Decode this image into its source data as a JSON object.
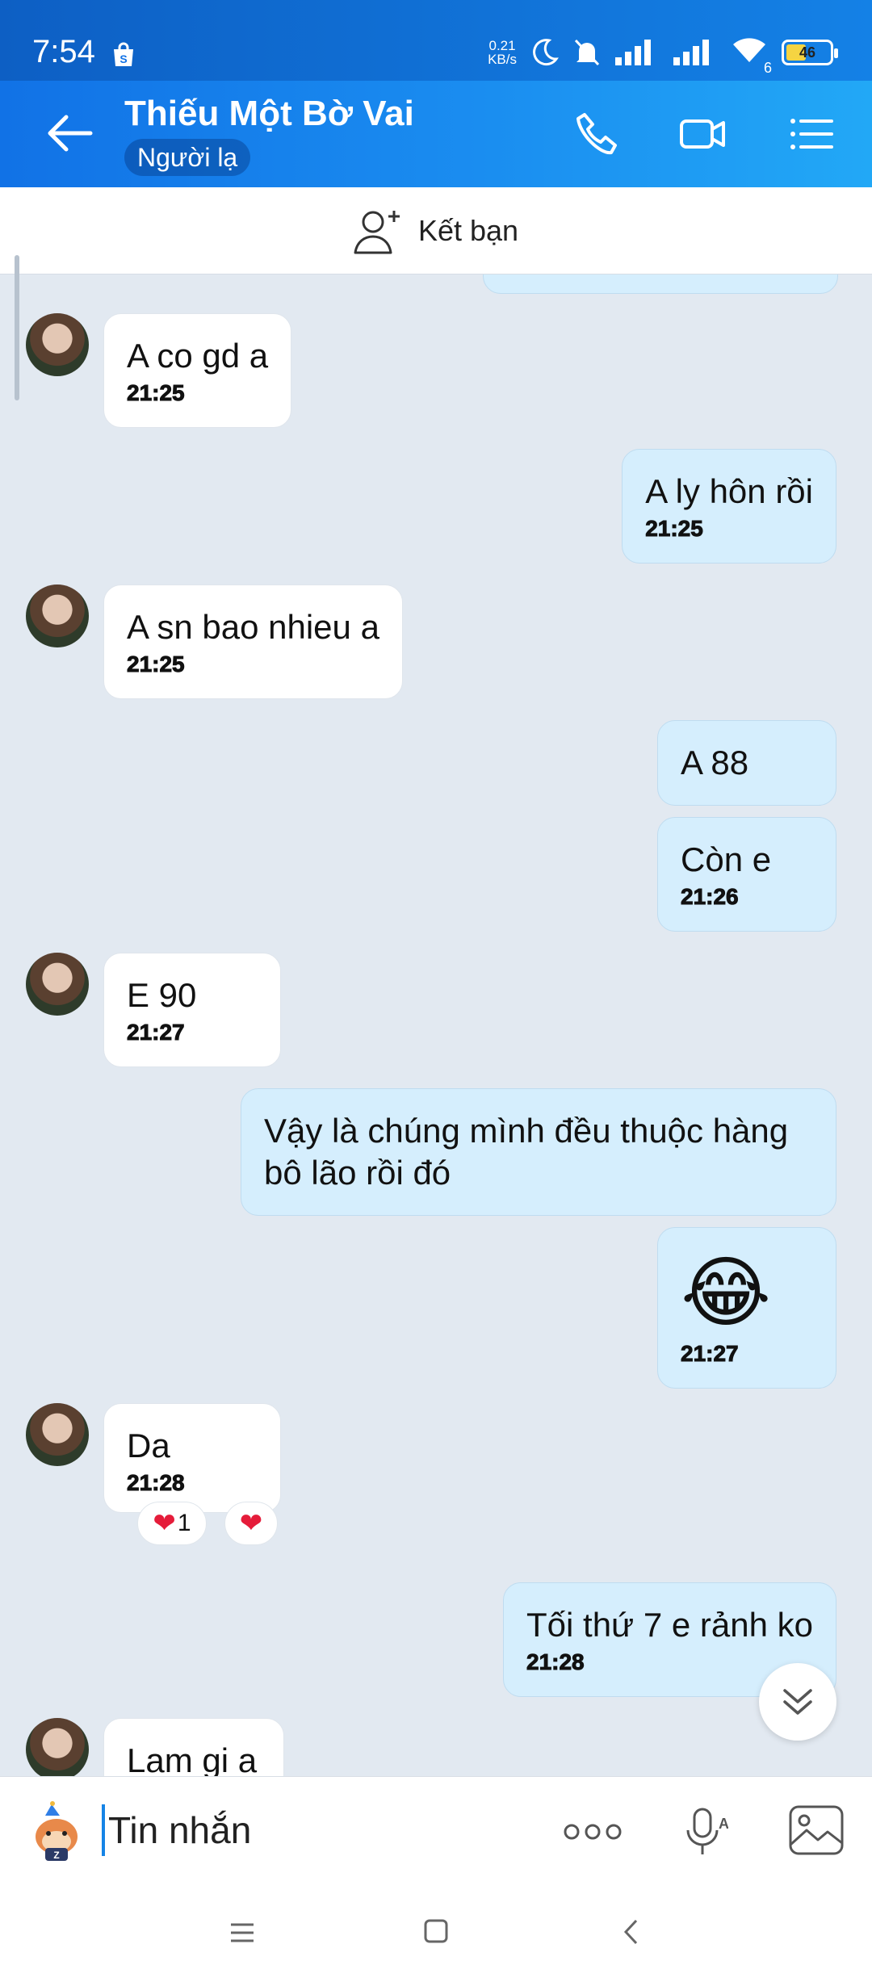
{
  "status_bar": {
    "time": "7:54",
    "net_speed_value": "0.21",
    "net_speed_unit": "KB/s",
    "wifi_badge": "6",
    "battery": "46",
    "battery_level": 0.46
  },
  "header": {
    "contact_name": "Thiếu Một Bờ Vai",
    "contact_status": "Người lạ"
  },
  "add_friend": {
    "label": "Kết bạn"
  },
  "messages": [
    {
      "dir": "in",
      "text": "A co gd a",
      "time": "21:25"
    },
    {
      "dir": "out",
      "text": "A ly hôn rồi",
      "time": "21:25"
    },
    {
      "dir": "in",
      "text": "A sn bao nhieu a",
      "time": "21:25"
    },
    {
      "dir": "out",
      "text": "A 88",
      "time": ""
    },
    {
      "dir": "out",
      "text": "Còn e",
      "time": "21:26"
    },
    {
      "dir": "in",
      "text": "E 90",
      "time": "21:27"
    },
    {
      "dir": "out",
      "text": "Vậy là chúng mình đều thuộc hàng bô lão rồi đó",
      "time": ""
    },
    {
      "dir": "out",
      "text": "😂",
      "time": "21:27"
    },
    {
      "dir": "in",
      "text": "Da",
      "time": "21:28",
      "reaction_count": "1"
    },
    {
      "dir": "out",
      "text": "Tối thứ 7 e rảnh ko",
      "time": "21:28"
    },
    {
      "dir": "in",
      "text": "Lam gi a",
      "time": ""
    }
  ],
  "composer": {
    "placeholder": "Tin nhắn"
  },
  "colors": {
    "header_start": "#1172e6",
    "header_end": "#22a8f6",
    "outgoing_bubble": "#d5eefd",
    "chat_bg": "#e2e9f1"
  }
}
